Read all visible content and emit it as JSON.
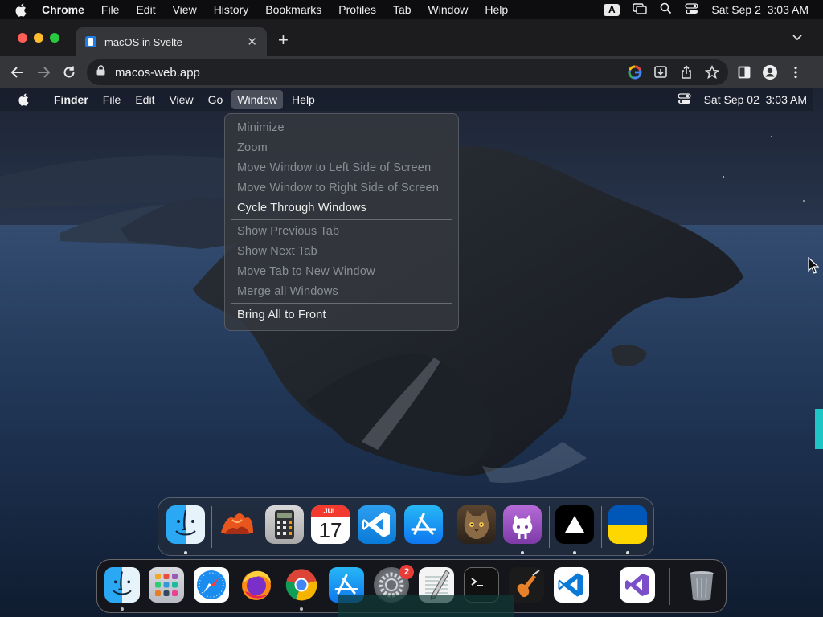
{
  "host_menubar": {
    "app": "Chrome",
    "items": [
      "File",
      "Edit",
      "View",
      "History",
      "Bookmarks",
      "Profiles",
      "Tab",
      "Window",
      "Help"
    ],
    "input_indicator": "A",
    "datetime": "Sat Sep 2  3:03 AM"
  },
  "browser": {
    "tab_title": "macOS in Svelte",
    "url": "macos-web.app"
  },
  "inner_menubar": {
    "app": "Finder",
    "items": [
      "File",
      "Edit",
      "View",
      "Go",
      "Window",
      "Help"
    ],
    "datetime": "Sat Sep 02  3:03 AM"
  },
  "window_menu": {
    "group1": [
      "Minimize",
      "Zoom",
      "Move Window to Left Side of Screen",
      "Move Window to Right Side of Screen",
      "Cycle Through Windows"
    ],
    "group2": [
      "Show Previous Tab",
      "Show Next Tab",
      "Move Tab to New Window",
      "Merge all Windows"
    ],
    "group3": [
      "Bring All to Front"
    ]
  },
  "calendar_icon": {
    "month": "JUL",
    "day": "17"
  },
  "host_dock": {
    "settings_badge": "2"
  },
  "colors": {
    "accent_blue": "#1f7de8",
    "vscode_blue": "#0a7ad8",
    "badge_red": "#ea3c36",
    "ukraine_blue": "#0057b7",
    "ukraine_yellow": "#ffd700"
  }
}
